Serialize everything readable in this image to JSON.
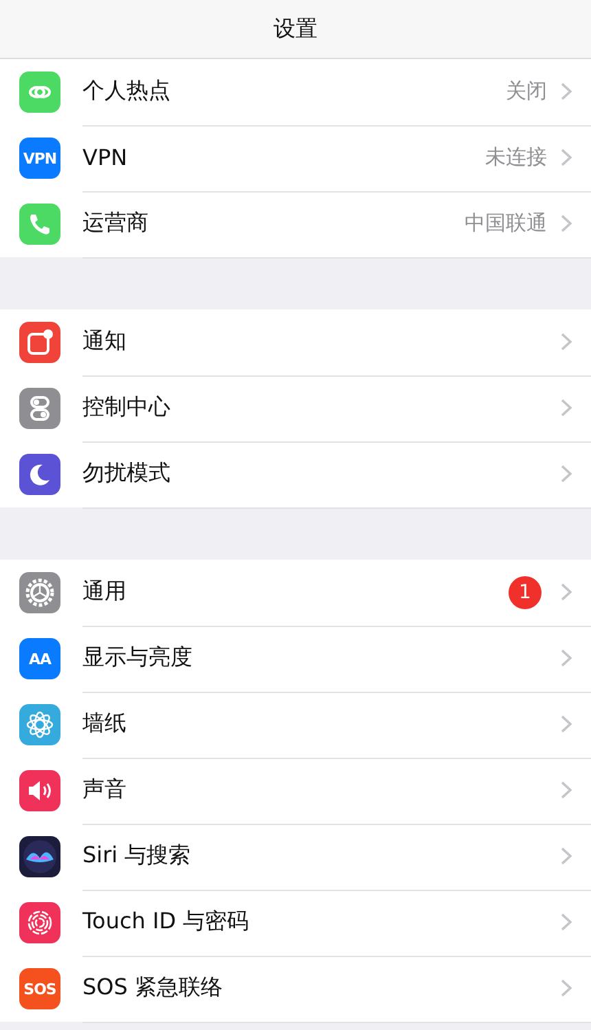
{
  "title": "设置",
  "groups": [
    {
      "items": [
        {
          "kind": "hotspot",
          "color": "#4cd964",
          "label": "个人热点",
          "value": "关闭"
        },
        {
          "kind": "text",
          "color": "#0a7aff",
          "icon_text": "VPN",
          "label": "VPN",
          "value": "未连接"
        },
        {
          "kind": "phone",
          "color": "#4cd964",
          "label": "运营商",
          "value": "中国联通"
        }
      ]
    },
    {
      "items": [
        {
          "kind": "notify",
          "color": "#f0443a",
          "label": "通知"
        },
        {
          "kind": "toggles",
          "color": "#8e8e93",
          "label": "控制中心"
        },
        {
          "kind": "moon",
          "color": "#5b52d6",
          "label": "勿扰模式"
        }
      ]
    },
    {
      "items": [
        {
          "kind": "gear",
          "color": "#8e8e93",
          "label": "通用",
          "badge": "1"
        },
        {
          "kind": "text",
          "color": "#0a7aff",
          "icon_text": "AA",
          "label": "显示与亮度"
        },
        {
          "kind": "flower",
          "color": "#35aadc",
          "label": "墙纸"
        },
        {
          "kind": "speaker",
          "color": "#f0325a",
          "label": "声音"
        },
        {
          "kind": "siri",
          "color": "#1c1c3c",
          "label": "Siri 与搜索"
        },
        {
          "kind": "fingerprint",
          "color": "#f0325a",
          "label": "Touch ID 与密码"
        },
        {
          "kind": "text",
          "color": "#f4511e",
          "icon_text": "SOS",
          "label": "SOS 紧急联络"
        }
      ]
    }
  ]
}
